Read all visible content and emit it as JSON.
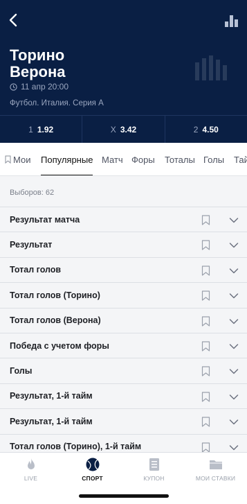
{
  "header": {
    "team_home": "Торино",
    "team_away": "Верона",
    "datetime": "11 апр 20:00",
    "league": "Футбол. Италия. Серия А",
    "odds": [
      {
        "key": "1",
        "value": "1.92"
      },
      {
        "key": "X",
        "value": "3.42"
      },
      {
        "key": "2",
        "value": "4.50"
      }
    ]
  },
  "tabs": {
    "mine": "Мои",
    "popular": "Популярные",
    "match": "Матч",
    "handicaps": "Форы",
    "totals": "Тоталы",
    "goals": "Голы",
    "more": "Тай"
  },
  "choices_label": "Выборов: 62",
  "markets": [
    "Результат матча",
    "Результат",
    "Тотал голов",
    "Тотал голов (Торино)",
    "Тотал голов (Верона)",
    "Победа с учетом форы",
    "Голы",
    "Результат, 1-й тайм",
    "Результат, 1-й тайм",
    "Тотал голов (Торино), 1-й тайм"
  ],
  "nav": {
    "live": "LIVE",
    "sport": "СПОРТ",
    "coupon": "КУПОН",
    "my_bets": "МОИ СТАВКИ"
  },
  "colors": {
    "header_bg": "#0a1f44",
    "accent": "#111111"
  }
}
